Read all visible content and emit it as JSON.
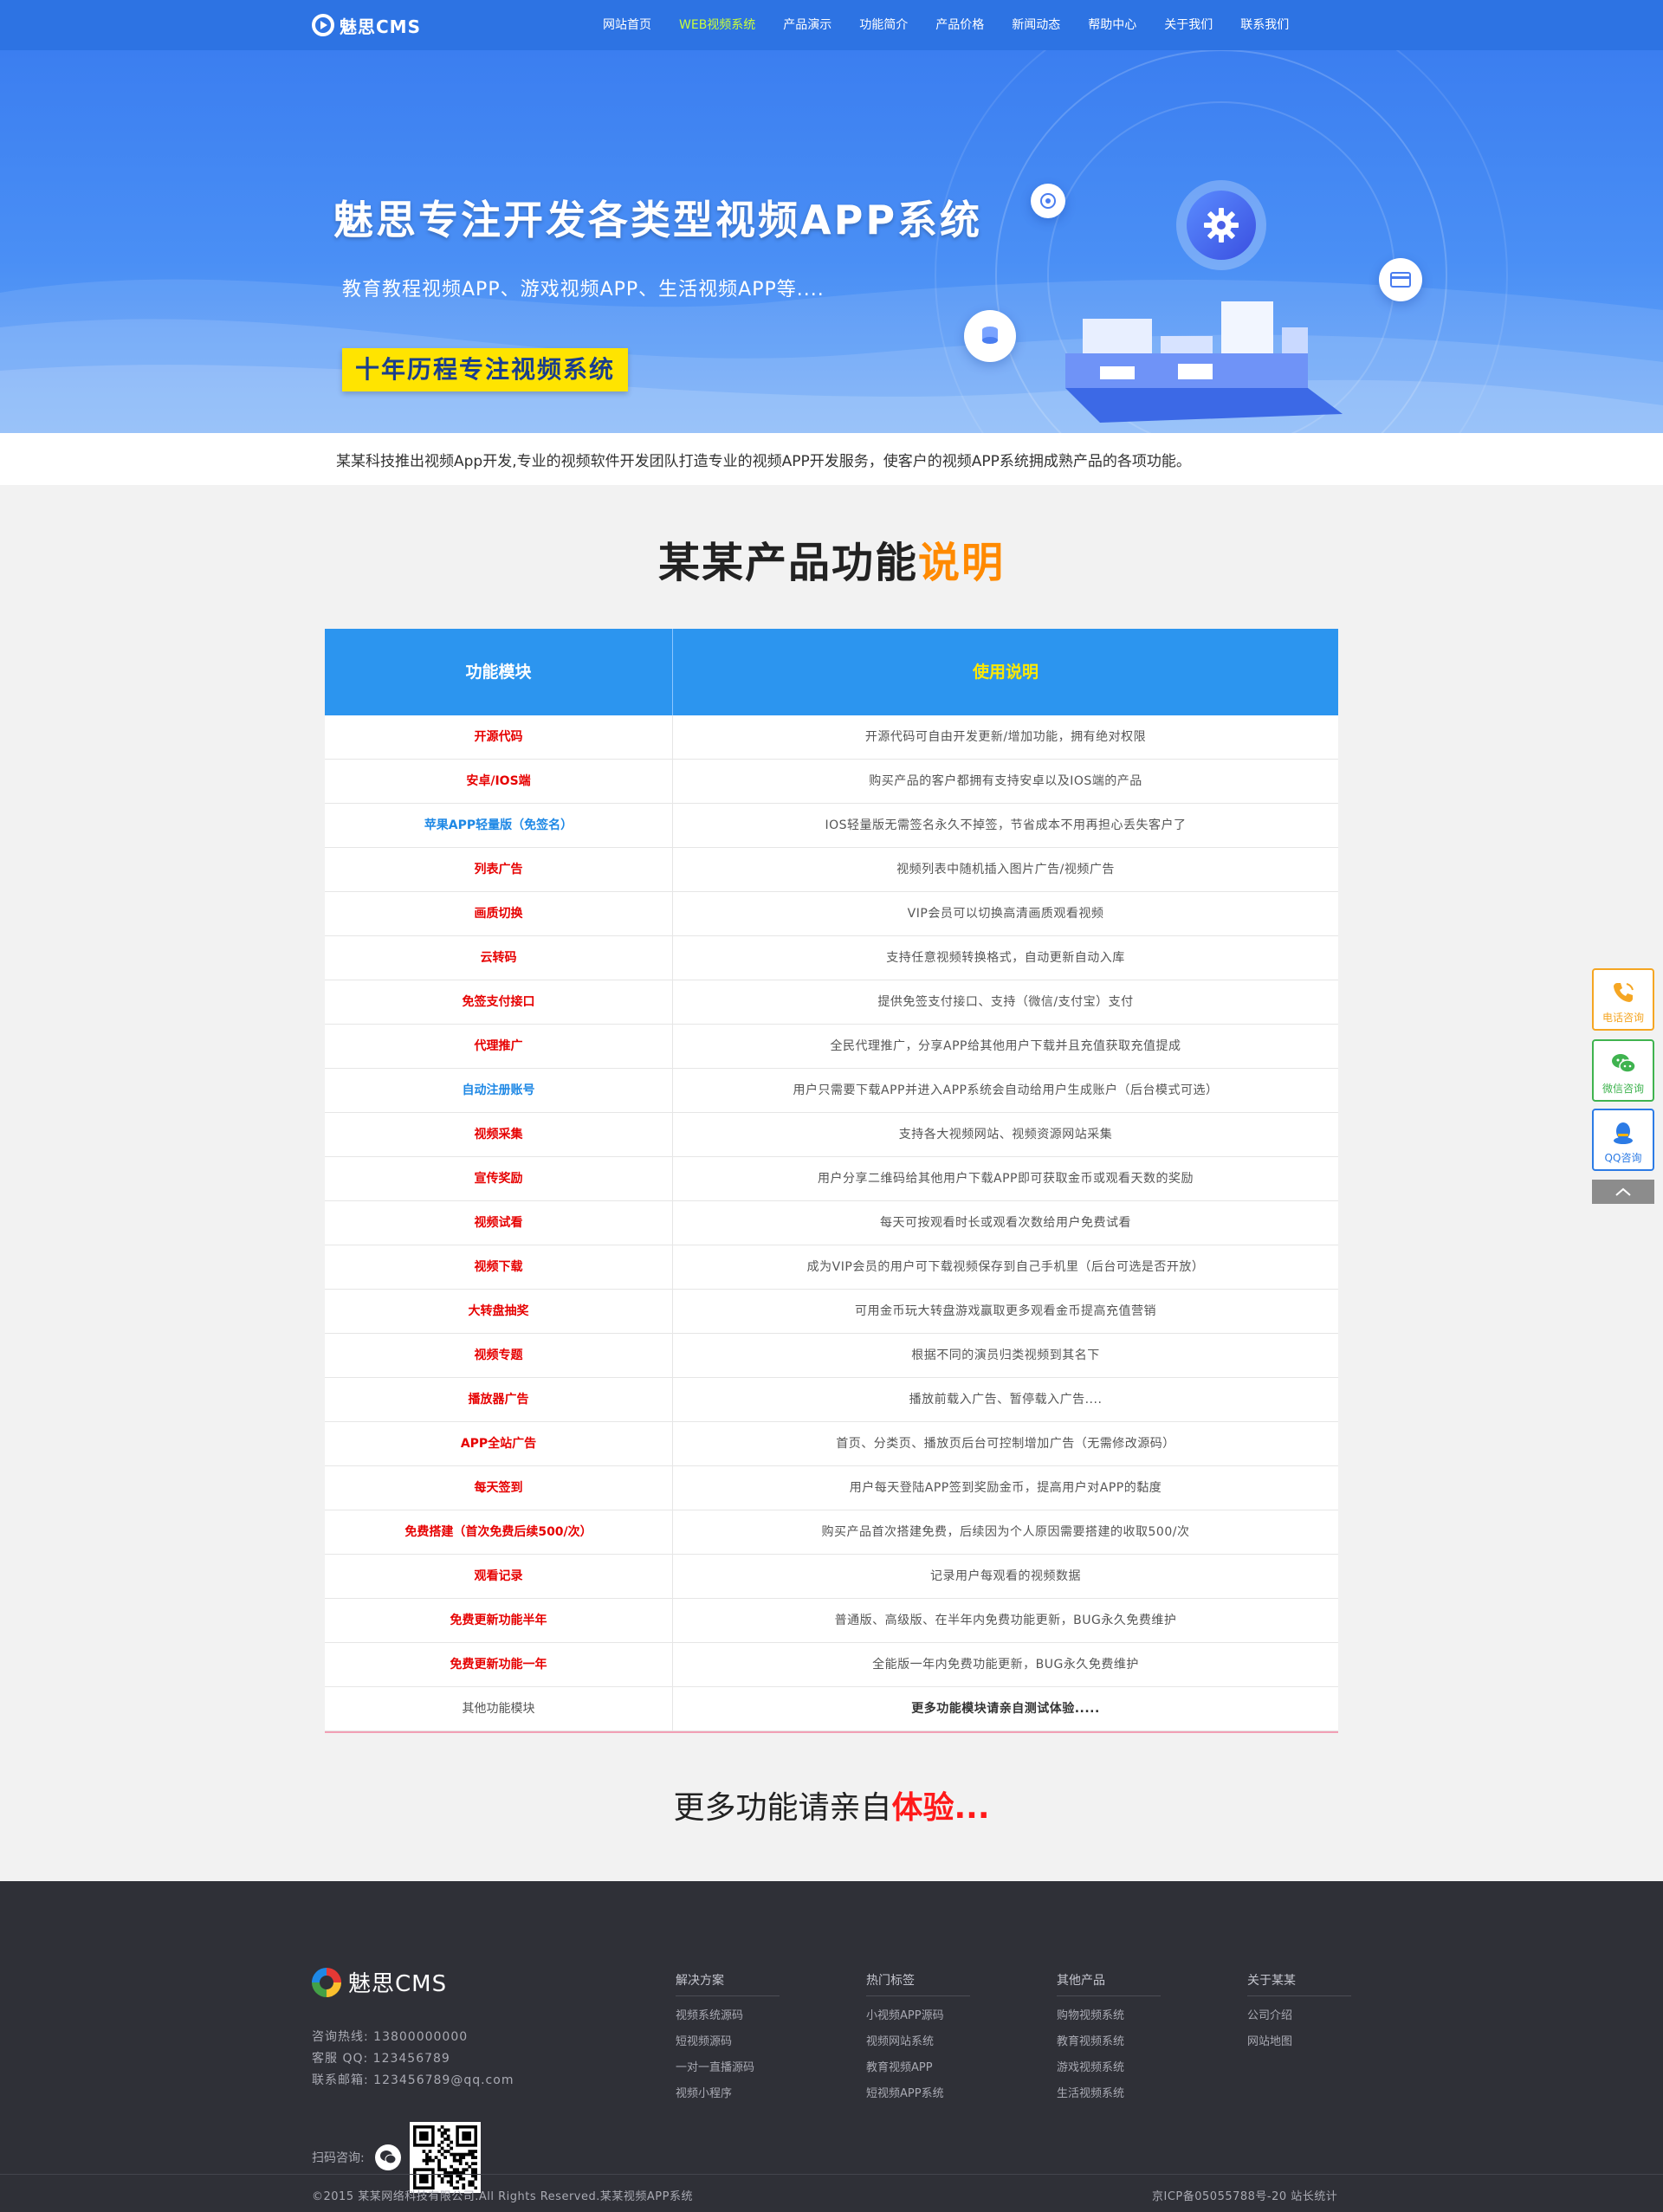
{
  "header": {
    "logo_text": "魅思CMS",
    "nav": [
      {
        "label": "网站首页",
        "active": false
      },
      {
        "label": "WEB视频系统",
        "active": true
      },
      {
        "label": "产品演示",
        "active": false
      },
      {
        "label": "功能简介",
        "active": false
      },
      {
        "label": "产品价格",
        "active": false
      },
      {
        "label": "新闻动态",
        "active": false
      },
      {
        "label": "帮助中心",
        "active": false
      },
      {
        "label": "关于我们",
        "active": false
      },
      {
        "label": "联系我们",
        "active": false
      }
    ]
  },
  "banner": {
    "title": "魅思专注开发各类型视频APP系统",
    "subtitle": "教育教程视频APP、游戏视频APP、生活视频APP等....",
    "badge": "十年历程专注视频系统"
  },
  "intro": "某某科技推出视频App开发,专业的视频软件开发团队打造专业的视频APP开发服务，使客户的视频APP系统拥成熟产品的各项功能。",
  "section": {
    "title_main": "某某产品功能",
    "title_highlight": "说明"
  },
  "table": {
    "col1": "功能模块",
    "col2": "使用说明",
    "rows": [
      {
        "name": "开源代码",
        "desc": "开源代码可自由开发更新/增加功能，拥有绝对权限",
        "style": "red"
      },
      {
        "name": "安卓/IOS端",
        "desc": "购买产品的客户都拥有支持安卓以及IOS端的产品",
        "style": "red"
      },
      {
        "name": "苹果APP轻量版（免签名）",
        "desc": "IOS轻量版无需签名永久不掉签，节省成本不用再担心丢失客户了",
        "style": "blue"
      },
      {
        "name": "列表广告",
        "desc": "视频列表中随机插入图片广告/视频广告",
        "style": "red"
      },
      {
        "name": "画质切换",
        "desc": "VIP会员可以切换高清画质观看视频",
        "style": "red"
      },
      {
        "name": "云转码",
        "desc": "支持任意视频转换格式，自动更新自动入库",
        "style": "red"
      },
      {
        "name": "免签支付接口",
        "desc": "提供免签支付接口、支持（微信/支付宝）支付",
        "style": "red"
      },
      {
        "name": "代理推广",
        "desc": "全民代理推广，分享APP给其他用户下载并且充值获取充值提成",
        "style": "red"
      },
      {
        "name": "自动注册账号",
        "desc": "用户只需要下载APP并进入APP系统会自动给用户生成账户（后台模式可选）",
        "style": "blue"
      },
      {
        "name": "视频采集",
        "desc": "支持各大视频网站、视频资源网站采集",
        "style": "red"
      },
      {
        "name": "宣传奖励",
        "desc": "用户分享二维码给其他用户下载APP即可获取金币或观看天数的奖励",
        "style": "red"
      },
      {
        "name": "视频试看",
        "desc": "每天可按观看时长或观看次数给用户免费试看",
        "style": "red"
      },
      {
        "name": "视频下载",
        "desc": "成为VIP会员的用户可下载视频保存到自己手机里（后台可选是否开放）",
        "style": "red"
      },
      {
        "name": "大转盘抽奖",
        "desc": "可用金币玩大转盘游戏赢取更多观看金币提高充值营销",
        "style": "red"
      },
      {
        "name": "视频专题",
        "desc": "根据不同的演员归类视频到其名下",
        "style": "red"
      },
      {
        "name": "播放器广告",
        "desc": "播放前载入广告、暂停载入广告....",
        "style": "red"
      },
      {
        "name": "APP全站广告",
        "desc": "首页、分类页、播放页后台可控制增加广告（无需修改源码）",
        "style": "red"
      },
      {
        "name": "每天签到",
        "desc": "用户每天登陆APP签到奖励金币，提高用户对APP的黏度",
        "style": "red"
      },
      {
        "name": "免费搭建（首次免费后续500/次）",
        "desc": "购买产品首次搭建免费，后续因为个人原因需要搭建的收取500/次",
        "style": "red"
      },
      {
        "name": "观看记录",
        "desc": "记录用户每观看的视频数据",
        "style": "red"
      },
      {
        "name": "免费更新功能半年",
        "desc": "普通版、高级版、在半年内免费功能更新，BUG永久免费维护",
        "style": "red"
      },
      {
        "name": "免费更新功能一年",
        "desc": "全能版一年内免费功能更新，BUG永久免费维护",
        "style": "red"
      },
      {
        "name": "其他功能模块",
        "desc": "更多功能模块请亲自测试体验.....",
        "style": "gray"
      }
    ]
  },
  "more": {
    "text": "更多功能请亲自",
    "highlight": "体验..."
  },
  "float": {
    "phone": "电话咨询",
    "wechat": "微信咨询",
    "qq": "QQ咨询"
  },
  "footer": {
    "logo_text": "魅思CMS",
    "hotline": "咨询热线: 13800000000",
    "qq": "客服 QQ: 123456789",
    "email": "联系邮箱: 123456789@qq.com",
    "scan": "扫码咨询:",
    "columns": [
      {
        "title": "解决方案",
        "items": [
          "视频系统源码",
          "短视频源码",
          "一对一直播源码",
          "视频小程序"
        ]
      },
      {
        "title": "热门标签",
        "items": [
          "小视频APP源码",
          "视频网站系统",
          "教育视频APP",
          "短视频APP系统"
        ]
      },
      {
        "title": "其他产品",
        "items": [
          "购物视频系统",
          "教育视频系统",
          "游戏视频系统",
          "生活视频系统"
        ]
      },
      {
        "title": "关于某某",
        "items": [
          "公司介绍",
          "网站地图"
        ]
      }
    ],
    "copyright": "©2015 某某网络科技有限公司.All Rights Reserved.某某视频APP系统",
    "icp": "京ICP备05055788号-20  站长统计"
  }
}
